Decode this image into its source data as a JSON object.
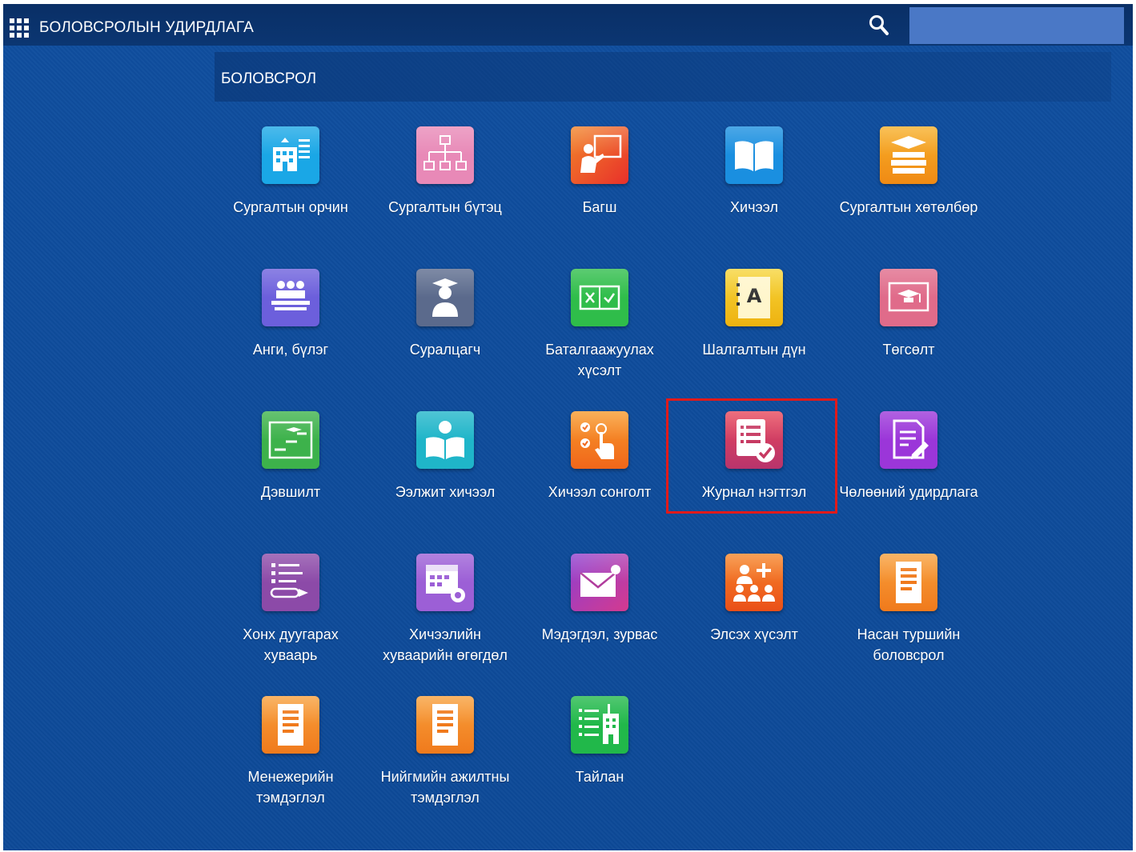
{
  "header": {
    "app_title": "БОЛОВСРОЛЫН УДИРДЛАГА",
    "search_value": ""
  },
  "section": {
    "title": "БОЛОВСРОЛ"
  },
  "tiles": [
    {
      "label": "Сургалтын орчин",
      "icon": "school-building-icon",
      "color": "#1aa7e6"
    },
    {
      "label": "Сургалтын бүтэц",
      "icon": "org-chart-icon",
      "color": "#e889b7"
    },
    {
      "label": "Багш",
      "icon": "teacher-board-icon",
      "color": "#ef4f2a"
    },
    {
      "label": "Хичээл",
      "icon": "open-book-icon",
      "color": "#1a8fe0"
    },
    {
      "label": "Сургалтын хөтөлбөр",
      "icon": "books-stack-icon",
      "color": "#f39b1d"
    },
    {
      "label": "Анги, бүлэг",
      "icon": "classroom-icon",
      "color": "#6c5fdc"
    },
    {
      "label": "Суралцагч",
      "icon": "graduate-student-icon",
      "color": "#5b6a8c"
    },
    {
      "label": "Баталгаажуулах хүсэлт",
      "icon": "approval-checkbox-icon",
      "color": "#2fbd4a"
    },
    {
      "label": "Шалгалтын дүн",
      "icon": "grade-report-icon",
      "color": "#f1c21b"
    },
    {
      "label": "Төгсөлт",
      "icon": "graduation-icon",
      "color": "#e06b8a"
    },
    {
      "label": "Дэвшилт",
      "icon": "progress-board-icon",
      "color": "#3db24b"
    },
    {
      "label": "Ээлжит хичээл",
      "icon": "reading-student-icon",
      "color": "#1fb5c9"
    },
    {
      "label": "Хичээл сонголт",
      "icon": "tap-checklist-icon",
      "color": "#f47b20"
    },
    {
      "label": "Журнал нэгтгэл",
      "icon": "journal-check-icon",
      "color": "#d63a5c"
    },
    {
      "label": "Чөлөөний удирдлага",
      "icon": "edit-document-icon",
      "color": "#9b36d9"
    },
    {
      "label": "Хонх дуугарах хуваарь",
      "icon": "bell-schedule-icon",
      "color": "#8c4aa8"
    },
    {
      "label": "Хичээлийн хуваарийн өгөгдөл",
      "icon": "calendar-settings-icon",
      "color": "#9c5fd6"
    },
    {
      "label": "Мэдэгдэл, зурвас",
      "icon": "envelope-icon",
      "color": "#c13fb5"
    },
    {
      "label": "Элсэх хүсэлт",
      "icon": "add-users-icon",
      "color": "#f26a1f"
    },
    {
      "label": "Насан туршийн боловсрол",
      "icon": "document-icon",
      "color": "#f58a2a"
    },
    {
      "label": "Менежерийн тэмдэглэл",
      "icon": "document-icon",
      "color": "#f58a2a"
    },
    {
      "label": "Нийгмийн ажилтны тэмдэглэл",
      "icon": "document-icon",
      "color": "#f58a2a"
    },
    {
      "label": "Тайлан",
      "icon": "report-list-icon",
      "color": "#21b84a"
    }
  ]
}
